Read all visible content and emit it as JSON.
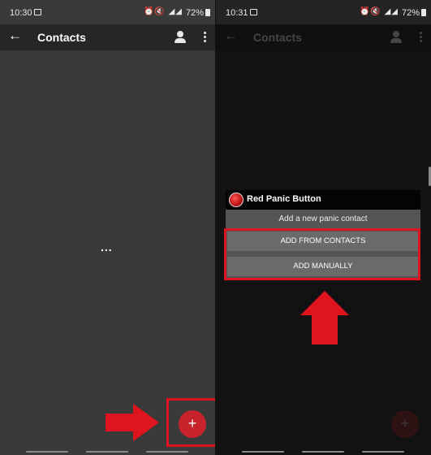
{
  "left": {
    "status": {
      "time": "10:30",
      "icons": "⏰🔇 ◢◢",
      "battery": "72%"
    },
    "appbar": {
      "title": "Contacts"
    },
    "loading": "...",
    "fab_label": "+"
  },
  "right": {
    "status": {
      "time": "10:31",
      "icons": "⏰🔇 ◢◢",
      "battery": "72%"
    },
    "appbar": {
      "title": "Contacts"
    },
    "dialog": {
      "title": "Red Panic Button",
      "subtitle": "Add a new panic contact",
      "buttons": [
        "ADD FROM CONTACTS",
        "ADD MANUALLY"
      ]
    },
    "fab_label": "+"
  },
  "colors": {
    "accent": "#c8232c",
    "highlight": "#e0141e",
    "dialog_header": "#050505",
    "dialog_body": "#555555",
    "left_background": "#3a3a3a",
    "right_background": "#242424"
  }
}
